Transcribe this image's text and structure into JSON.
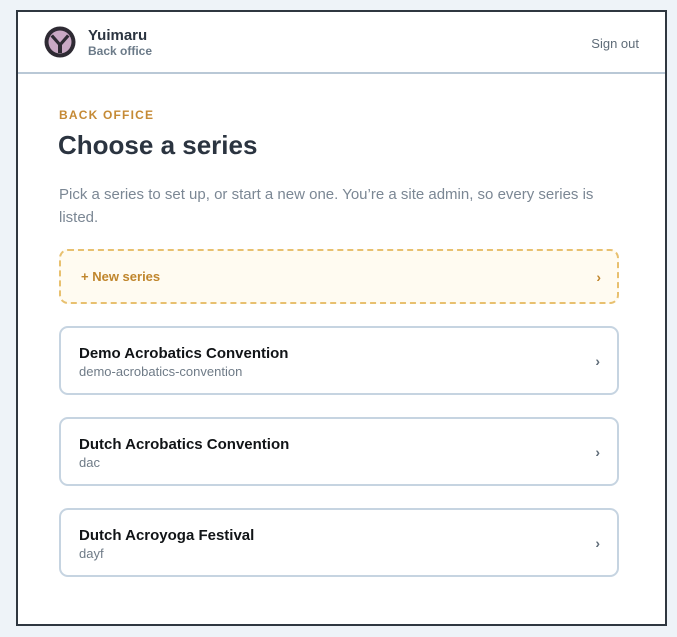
{
  "header": {
    "brand_name": "Yuimaru",
    "brand_subtitle": "Back office",
    "sign_out_label": "Sign out",
    "logo_icon": "yuimaru-logo-icon"
  },
  "main": {
    "eyebrow": "BACK OFFICE",
    "title": "Choose a series",
    "intro": "Pick a series to set up, or start a new one. You’re a site admin, so every series is listed.",
    "new_series": {
      "label": "+ New series",
      "chevron": "›"
    },
    "series": [
      {
        "name": "Demo Acrobatics Convention",
        "slug": "demo-acrobatics-convention",
        "chevron": "›"
      },
      {
        "name": "Dutch Acrobatics Convention",
        "slug": "dac",
        "chevron": "›"
      },
      {
        "name": "Dutch Acroyoga Festival",
        "slug": "dayf",
        "chevron": "›"
      }
    ]
  },
  "colors": {
    "accent": "#c58a35",
    "accent_bg": "#fffbf1",
    "text_dark": "#2b3440",
    "card_border": "#c6d4e1",
    "logo_dark": "#2e2a33",
    "logo_light": "#c9a8c4"
  }
}
